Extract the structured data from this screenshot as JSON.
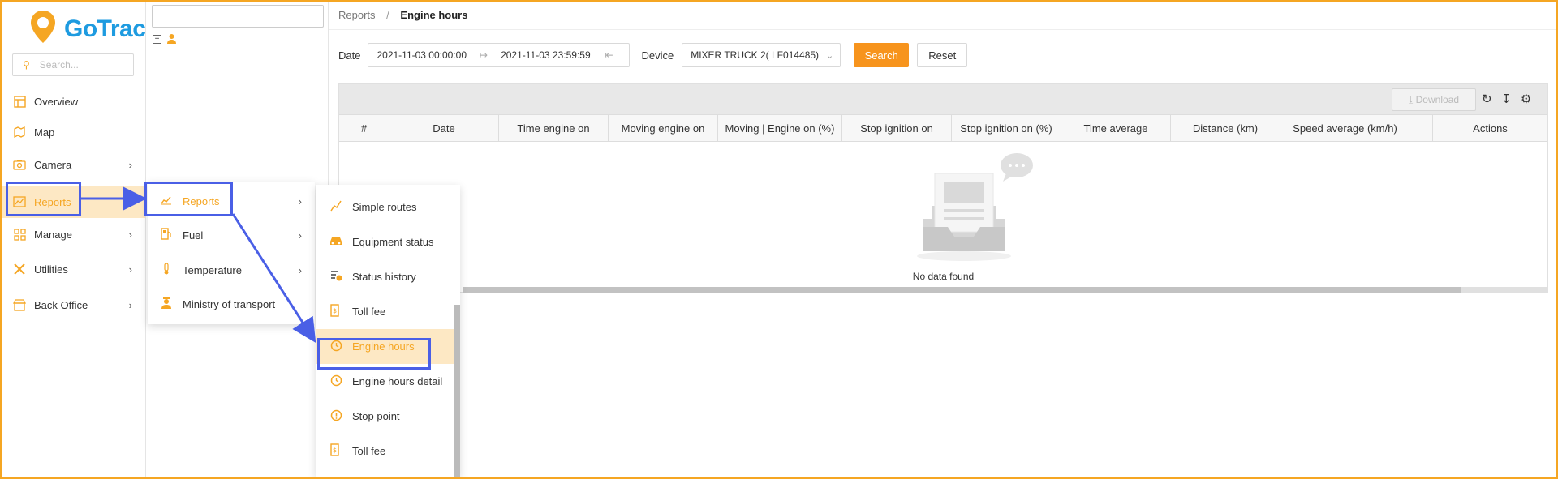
{
  "app": {
    "name": "GoTrack"
  },
  "sidebar": {
    "search_placeholder": "Search...",
    "items": [
      {
        "label": "Overview",
        "icon": "layout-icon",
        "chevron": ""
      },
      {
        "label": "Map",
        "icon": "map-icon",
        "chevron": ""
      },
      {
        "label": "Camera",
        "icon": "camera-icon",
        "chevron": "›"
      },
      {
        "label": "Reports",
        "icon": "chart-icon",
        "chevron": ""
      },
      {
        "label": "Manage",
        "icon": "grid-icon",
        "chevron": "›"
      },
      {
        "label": "Utilities",
        "icon": "tools-icon",
        "chevron": "›"
      },
      {
        "label": "Back Office",
        "icon": "store-icon",
        "chevron": "›"
      }
    ]
  },
  "breadcrumb": {
    "parent": "Reports",
    "separator": "/",
    "current": "Engine hours"
  },
  "filters": {
    "date_label": "Date",
    "date_from": "2021-11-03 00:00:00",
    "date_to": "2021-11-03 23:59:59",
    "device_label": "Device",
    "device_value": "MIXER TRUCK 2( LF014485)",
    "search_label": "Search",
    "reset_label": "Reset"
  },
  "grid": {
    "download_label": "Download",
    "columns": [
      "#",
      "Date",
      "Time engine on",
      "Moving engine on",
      "Moving | Engine on (%)",
      "Stop ignition on",
      "Stop ignition on (%)",
      "Time average",
      "Distance (km)",
      "Speed average (km/h)",
      "",
      "Actions"
    ],
    "empty_text": "No data found"
  },
  "menu_level1": {
    "items": [
      {
        "label": "Reports",
        "icon": "chart-icon",
        "chevron": "›"
      },
      {
        "label": "Fuel",
        "icon": "fuel-icon",
        "chevron": "›"
      },
      {
        "label": "Temperature",
        "icon": "thermometer-icon",
        "chevron": "›"
      },
      {
        "label": "Ministry of transport",
        "icon": "officer-icon",
        "chevron": ""
      }
    ]
  },
  "menu_level2": {
    "items": [
      {
        "label": "Simple routes",
        "icon": "route-icon"
      },
      {
        "label": "Equipment status",
        "icon": "car-icon"
      },
      {
        "label": "Status history",
        "icon": "history-icon"
      },
      {
        "label": "Toll fee",
        "icon": "toll-icon"
      },
      {
        "label": "Engine hours",
        "icon": "clock-icon"
      },
      {
        "label": "Engine hours detail",
        "icon": "clock-icon"
      },
      {
        "label": "Stop point",
        "icon": "alert-icon"
      },
      {
        "label": "Toll fee",
        "icon": "toll-icon"
      }
    ]
  },
  "colors": {
    "accent": "#f7941d",
    "brand_blue": "#1e9be0",
    "highlight": "#4a5fe6",
    "active_bg": "#fde8c4"
  }
}
